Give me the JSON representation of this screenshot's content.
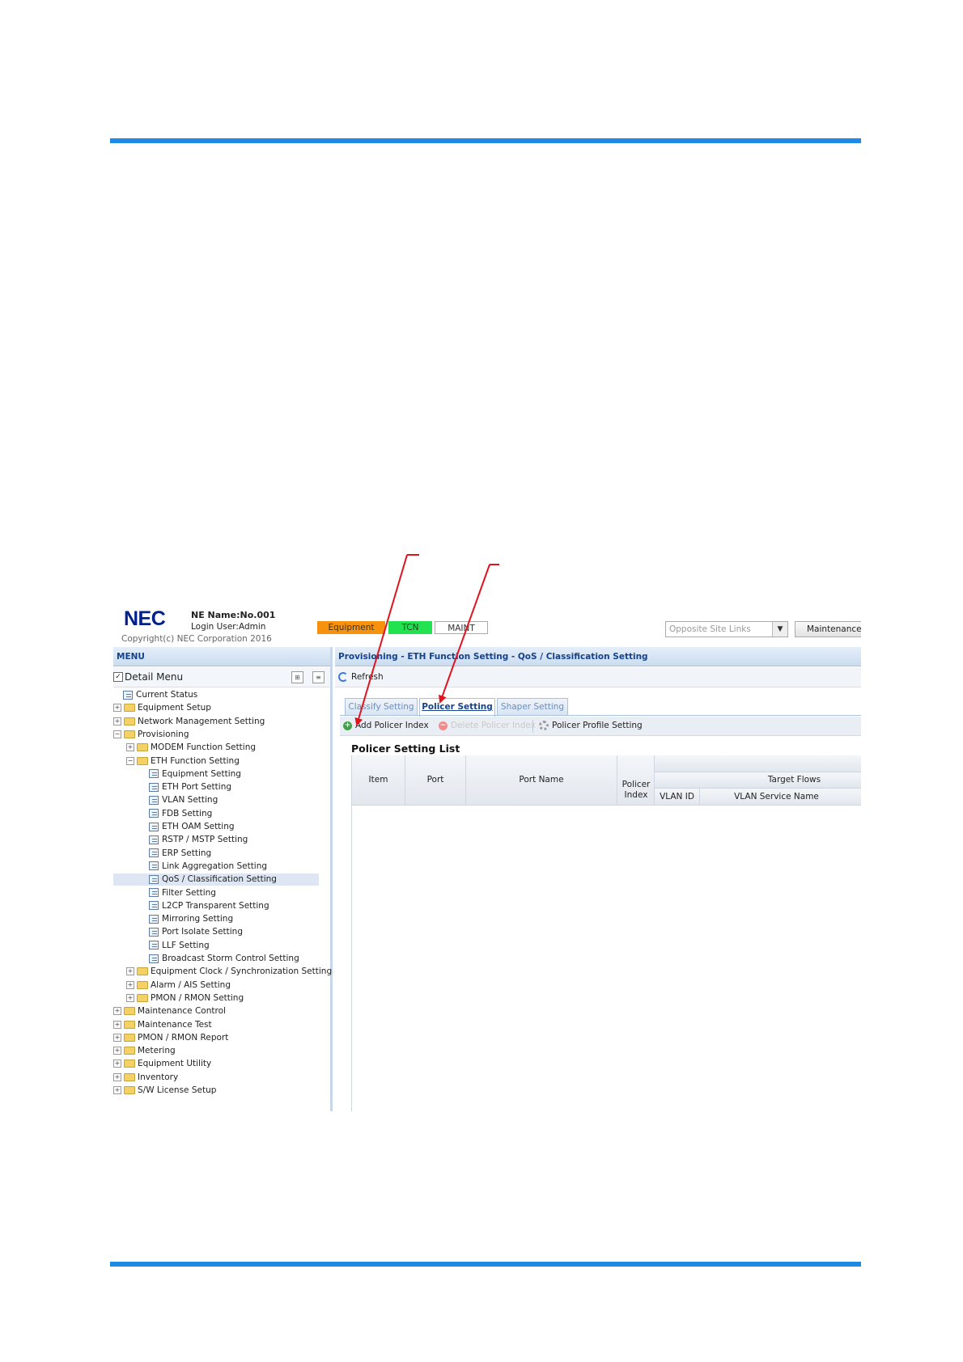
{
  "header": {
    "logo": "NEC",
    "ne_name": "NE Name:No.001",
    "login_user": "Login User:Admin",
    "copyright": "Copyright(c) NEC Corporation 2016",
    "status": {
      "equipment": "Equipment",
      "tcn": "TCN",
      "maint": "MAINT"
    },
    "status_colors": {
      "equipment": "#f7920f",
      "tcn": "#22e34f",
      "maint": "#ffffff"
    },
    "opposite_site_links": "Opposite Site Links",
    "maintenance_button": "Maintenance"
  },
  "menu": {
    "header": "MENU",
    "detail_menu": "Detail Menu",
    "detail_menu_checked": true,
    "items": [
      {
        "label": "Current Status",
        "type": "page",
        "level": 0
      },
      {
        "label": "Equipment Setup",
        "type": "folder",
        "level": 0,
        "expanded": false
      },
      {
        "label": "Network Management Setting",
        "type": "folder",
        "level": 0,
        "expanded": false
      },
      {
        "label": "Provisioning",
        "type": "folder",
        "level": 0,
        "expanded": true
      },
      {
        "label": "MODEM Function Setting",
        "type": "folder",
        "level": 1,
        "expanded": false
      },
      {
        "label": "ETH Function Setting",
        "type": "folder",
        "level": 1,
        "expanded": true
      },
      {
        "label": "Equipment Setting",
        "type": "page",
        "level": 2
      },
      {
        "label": "ETH Port Setting",
        "type": "page",
        "level": 2
      },
      {
        "label": "VLAN Setting",
        "type": "page",
        "level": 2
      },
      {
        "label": "FDB Setting",
        "type": "page",
        "level": 2
      },
      {
        "label": "ETH OAM Setting",
        "type": "page",
        "level": 2
      },
      {
        "label": "RSTP / MSTP Setting",
        "type": "page",
        "level": 2
      },
      {
        "label": "ERP Setting",
        "type": "page",
        "level": 2
      },
      {
        "label": "Link Aggregation Setting",
        "type": "page",
        "level": 2
      },
      {
        "label": "QoS / Classification Setting",
        "type": "page",
        "level": 2,
        "selected": true
      },
      {
        "label": "Filter Setting",
        "type": "page",
        "level": 2
      },
      {
        "label": "L2CP Transparent Setting",
        "type": "page",
        "level": 2
      },
      {
        "label": "Mirroring Setting",
        "type": "page",
        "level": 2
      },
      {
        "label": "Port Isolate Setting",
        "type": "page",
        "level": 2
      },
      {
        "label": "LLF Setting",
        "type": "page",
        "level": 2
      },
      {
        "label": "Broadcast Storm Control Setting",
        "type": "page",
        "level": 2
      },
      {
        "label": "Equipment Clock / Synchronization Setting",
        "type": "folder",
        "level": 1,
        "expanded": false
      },
      {
        "label": "Alarm / AIS Setting",
        "type": "folder",
        "level": 1,
        "expanded": false
      },
      {
        "label": "PMON / RMON Setting",
        "type": "folder",
        "level": 1,
        "expanded": false
      },
      {
        "label": "Maintenance Control",
        "type": "folder",
        "level": 0,
        "expanded": false
      },
      {
        "label": "Maintenance Test",
        "type": "folder",
        "level": 0,
        "expanded": false
      },
      {
        "label": "PMON / RMON Report",
        "type": "folder",
        "level": 0,
        "expanded": false
      },
      {
        "label": "Metering",
        "type": "folder",
        "level": 0,
        "expanded": false
      },
      {
        "label": "Equipment Utility",
        "type": "folder",
        "level": 0,
        "expanded": false
      },
      {
        "label": "Inventory",
        "type": "folder",
        "level": 0,
        "expanded": false
      },
      {
        "label": "S/W License Setup",
        "type": "folder",
        "level": 0,
        "expanded": false
      }
    ]
  },
  "main": {
    "title": "Provisioning - ETH Function Setting - QoS / Classification Setting",
    "refresh": "Refresh",
    "tabs": [
      {
        "label": "Classify Setting",
        "active": false
      },
      {
        "label": "Policer Setting",
        "active": true
      },
      {
        "label": "Shaper Setting",
        "active": false
      }
    ],
    "toolbar": {
      "add": "Add Policer Index",
      "delete": "Delete Policer Index",
      "profile": "Policer Profile Setting"
    },
    "list_title": "Policer Setting List",
    "columns": {
      "item": "Item",
      "port": "Port",
      "port_name": "Port Name",
      "policer_index": "Policer Index",
      "target_flows": "Target Flows",
      "vlan_id": "VLAN ID",
      "vlan_service_name": "VLAN Service Name"
    },
    "rows": []
  },
  "colors": {
    "brand_blue": "#1d8ae6",
    "annotation_arrow": "#e0141e",
    "panel_header_text": "#15428b"
  }
}
